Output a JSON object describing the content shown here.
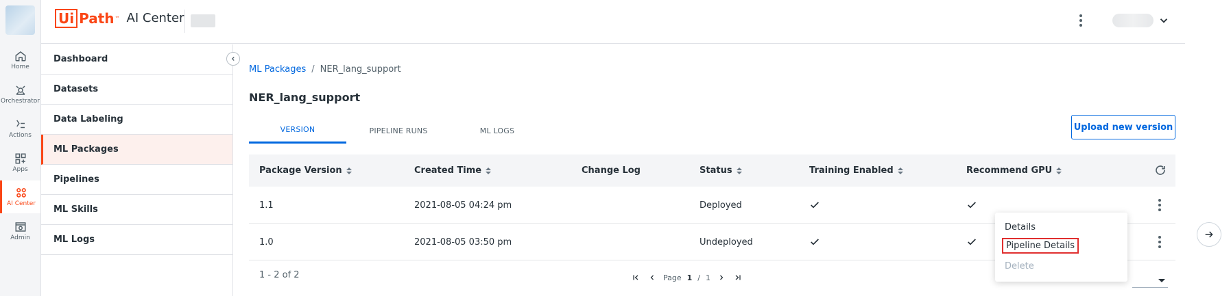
{
  "app": {
    "logo_box": "Ui",
    "logo_path": "Path",
    "logo_tm": "™",
    "product": "AI Center"
  },
  "rail": {
    "items": [
      {
        "label": "Home",
        "icon": "home-icon"
      },
      {
        "label": "Orchestrator",
        "icon": "orchestrator-icon"
      },
      {
        "label": "Actions",
        "icon": "actions-icon"
      },
      {
        "label": "Apps",
        "icon": "apps-icon"
      },
      {
        "label": "AI Center",
        "icon": "ai-center-icon",
        "active": true
      },
      {
        "label": "Admin",
        "icon": "admin-icon"
      }
    ]
  },
  "sidebar": {
    "items": [
      {
        "label": "Dashboard"
      },
      {
        "label": "Datasets"
      },
      {
        "label": "Data Labeling"
      },
      {
        "label": "ML Packages",
        "active": true
      },
      {
        "label": "Pipelines"
      },
      {
        "label": "ML Skills"
      },
      {
        "label": "ML Logs"
      }
    ]
  },
  "breadcrumb": {
    "root": "ML Packages",
    "separator": "/",
    "current": "NER_lang_support"
  },
  "page": {
    "title": "NER_lang_support"
  },
  "tabs": [
    {
      "label": "VERSION",
      "active": true
    },
    {
      "label": "PIPELINE RUNS"
    },
    {
      "label": "ML LOGS"
    }
  ],
  "actions": {
    "upload_label": "Upload new version"
  },
  "table": {
    "columns": [
      {
        "label": "Package Version",
        "sortable": true
      },
      {
        "label": "Created Time",
        "sortable": true
      },
      {
        "label": "Change Log",
        "sortable": false
      },
      {
        "label": "Status",
        "sortable": true
      },
      {
        "label": "Training Enabled",
        "sortable": true
      },
      {
        "label": "Recommend GPU",
        "sortable": true
      }
    ],
    "rows": [
      {
        "version": "1.1",
        "created": "2021-08-05 04:24 pm",
        "change_log": "",
        "status": "Deployed",
        "training_enabled": true,
        "recommend_gpu": true
      },
      {
        "version": "1.0",
        "created": "2021-08-05 03:50 pm",
        "change_log": "",
        "status": "Undeployed",
        "training_enabled": true,
        "recommend_gpu": true
      }
    ],
    "footer": {
      "count": "1 - 2 of 2",
      "page_label": "Page",
      "page_current": "1",
      "page_sep": "/",
      "page_total": "1"
    }
  },
  "context_menu": {
    "items": [
      {
        "label": "Details",
        "state": "enabled"
      },
      {
        "label": "Pipeline Details",
        "state": "highlighted"
      },
      {
        "label": "Delete",
        "state": "disabled"
      }
    ]
  },
  "colors": {
    "brand": "#fa4616",
    "link": "#0067df",
    "highlight_border": "#e02f2f"
  }
}
